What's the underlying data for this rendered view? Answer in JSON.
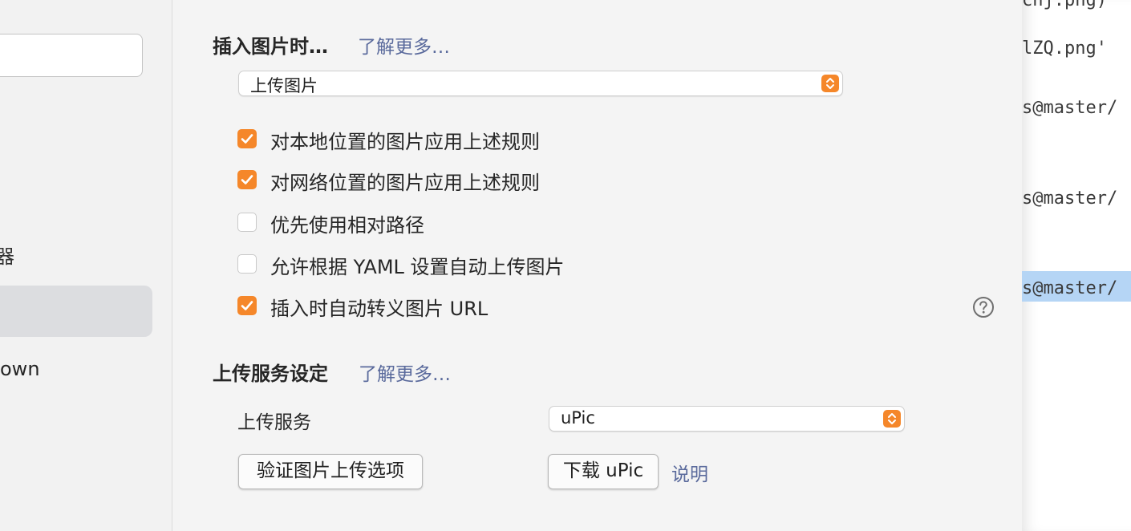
{
  "sidebar": {
    "fragment_1": "器",
    "fragment_2": "own"
  },
  "image_insert": {
    "title": "插入图片时…",
    "learn_more": "了解更多…",
    "action_value": "上传图片",
    "options": [
      {
        "label": "对本地位置的图片应用上述规则",
        "checked": true
      },
      {
        "label": "对网络位置的图片应用上述规则",
        "checked": true
      },
      {
        "label": "优先使用相对路径",
        "checked": false
      },
      {
        "label": "允许根据 YAML 设置自动上传图片",
        "checked": false
      },
      {
        "label": "插入时自动转义图片 URL",
        "checked": true
      }
    ]
  },
  "upload": {
    "title": "上传服务设定",
    "learn_more": "了解更多…",
    "service_label": "上传服务",
    "service_value": "uPic",
    "verify_button": "验证图片上传选项",
    "download_button": "下载 uPic",
    "explain_link": "说明"
  },
  "editor": {
    "lines": [
      "cnj.png)",
      "lZQ.png'",
      "s@master/",
      "s@master/",
      "s@master/"
    ]
  },
  "colors": {
    "accent": "#f5872a",
    "link": "#5a6a9c",
    "selection": "#b5d5f5"
  }
}
